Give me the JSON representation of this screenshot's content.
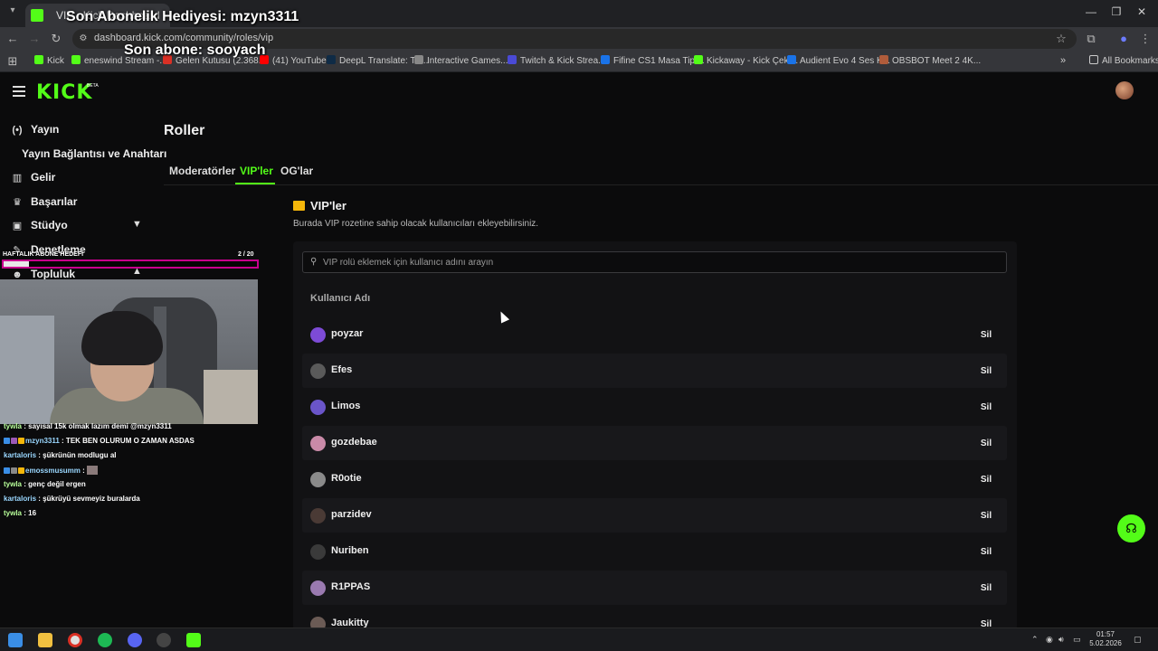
{
  "browser": {
    "tab_title": "VIP - Kick Dashboard",
    "url": "dashboard.kick.com/community/roles/vip",
    "bookmarks": [
      {
        "label": "Kick",
        "color": "#53fc18"
      },
      {
        "label": "eneswind Stream -...",
        "color": "#53fc18"
      },
      {
        "label": "Gelen Kutusu (2.368...",
        "color": "#d93025"
      },
      {
        "label": "(41) YouTube",
        "color": "#ff0000"
      },
      {
        "label": "DeepL Translate: Th...",
        "color": "#0f2b46"
      },
      {
        "label": "Interactive Games...",
        "color": "#888888"
      },
      {
        "label": "Twitch & Kick Strea...",
        "color": "#4a4ad6"
      },
      {
        "label": "Fifine CS1 Masa Tipi...",
        "color": "#1a73e8"
      },
      {
        "label": "Kickaway - Kick Çeki...",
        "color": "#53fc18"
      },
      {
        "label": "Audient Evo 4 Ses K...",
        "color": "#1a73e8"
      },
      {
        "label": "OBSBOT Meet 2 4K...",
        "color": "#b05c3b"
      }
    ],
    "all_bookmarks": "All Bookmarks"
  },
  "overlay": {
    "gift_text": "Son Abonelik Hediyesi: mzyn3311",
    "sub_text": "Son abone: sooyach",
    "goal_label": "HAFTALIK ABONE HEDEFİ",
    "goal_count": "2  / 20",
    "goal_progress": 0.1
  },
  "sidebar": {
    "logo": "KICK",
    "beta": "BETA",
    "items": [
      {
        "label": "Yayın",
        "icon": "broadcast-icon",
        "glyph": "(•)"
      },
      {
        "label": "Yayın Bağlantısı ve Anahtarı",
        "icon": "",
        "glyph": ""
      },
      {
        "label": "Gelir",
        "icon": "chart-icon",
        "glyph": "▥"
      },
      {
        "label": "Başarılar",
        "icon": "trophy-icon",
        "glyph": "♛"
      },
      {
        "label": "Stüdyo",
        "icon": "studio-icon",
        "glyph": "▣"
      },
      {
        "label": "Denetleme",
        "icon": "wrench-icon",
        "glyph": "✎"
      },
      {
        "label": "Topluluk",
        "icon": "community-icon",
        "glyph": "☻"
      }
    ]
  },
  "main": {
    "title": "Roller",
    "tabs": [
      "Moderatörler",
      "VIP'ler",
      "OG'lar"
    ],
    "section_title": "VIP'ler",
    "section_desc": "Burada VIP rozetine sahip olacak kullanıcıları ekleyebilirsiniz.",
    "search_placeholder": "VIP rolü eklemek için kullanıcı adını arayın",
    "column_header": "Kullanıcı Adı",
    "remove_label": "Sil",
    "vips": [
      {
        "name": "poyzar",
        "avatar_color": "#7d4bd6"
      },
      {
        "name": "Efes",
        "avatar_color": "#5a5a5a"
      },
      {
        "name": "Limos",
        "avatar_color": "#6a55c9"
      },
      {
        "name": "gozdebae",
        "avatar_color": "#c98aa8"
      },
      {
        "name": "R0otie",
        "avatar_color": "#8a8a8a"
      },
      {
        "name": "parzidev",
        "avatar_color": "#4a3a35"
      },
      {
        "name": "Nuriben",
        "avatar_color": "#3a3a3a"
      },
      {
        "name": "R1PPAS",
        "avatar_color": "#9a7ab0"
      },
      {
        "name": "Jaukitty",
        "avatar_color": "#6b5b55"
      }
    ]
  },
  "chat": [
    {
      "user": "tywla",
      "text": ": sayısal 15k olmak lazım demi @mzyn3311",
      "user_color": "#b8ff9a",
      "badges": []
    },
    {
      "user": "mzyn3311",
      "text": ": TEK BEN OLURUM O ZAMAN ASDAS",
      "user_color": "#9ad7ff",
      "badges": [
        "#3a8ee6",
        "#9b59b6",
        "#f5b70a"
      ]
    },
    {
      "user": "kartaloris",
      "text": ": şükrünün modlugu al",
      "user_color": "#9ad7ff",
      "badges": []
    },
    {
      "user": "emossmusumm",
      "text": ":",
      "user_color": "#9ad7ff",
      "badges": [
        "#3a8ee6",
        "#888888",
        "#f5b70a"
      ]
    },
    {
      "user": "tywla",
      "text": ": genç değil ergen",
      "user_color": "#b8ff9a",
      "badges": []
    },
    {
      "user": "kartaloris",
      "text": ": şükrüyü sevmeyiz buralarda",
      "user_color": "#9ad7ff",
      "badges": []
    },
    {
      "user": "tywla",
      "text": ": 16",
      "user_color": "#b8ff9a",
      "badges": []
    }
  ],
  "taskbar": {
    "time": "01:57",
    "date": "5.02.2026"
  },
  "colors": {
    "accent": "#53fc18",
    "vip_gold": "#f5b70a"
  }
}
